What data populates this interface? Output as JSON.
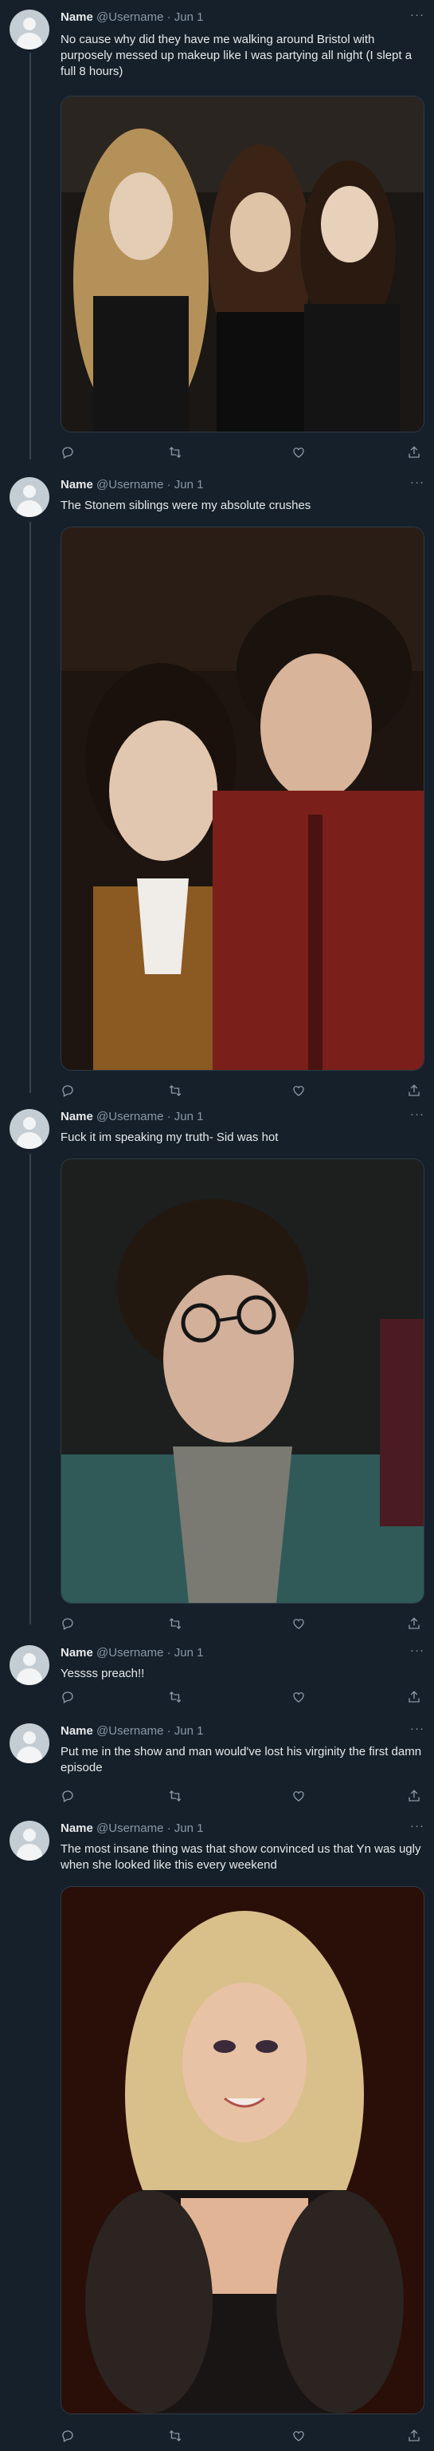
{
  "colors": {
    "background": "#15202b",
    "text": "#e7e9ea",
    "muted": "#8b98a5",
    "divider": "#38444d"
  },
  "tweets": [
    {
      "name": "Name",
      "handle": "@Username",
      "sep": "·",
      "date": "Jun 1",
      "text": "No cause why did they have me walking around Bristol with purposely messed up makeup like I was partying all night (I slept a full 8 hours)",
      "media": "photo-three-girls"
    },
    {
      "name": "Name",
      "handle": "@Username",
      "sep": "·",
      "date": "Jun 1",
      "text": "The Stonem siblings were my absolute crushes",
      "media": "photo-siblings"
    },
    {
      "name": "Name",
      "handle": "@Username",
      "sep": "·",
      "date": "Jun 1",
      "text": "Fuck it im speaking my truth- Sid was hot",
      "media": "photo-sid"
    },
    {
      "name": "Name",
      "handle": "@Username",
      "sep": "·",
      "date": "Jun 1",
      "text": "Yessss preach!!"
    },
    {
      "name": "Name",
      "handle": "@Username",
      "sep": "·",
      "date": "Jun 1",
      "text": "Put me in the show and man would've lost his virginity the first damn episode"
    },
    {
      "name": "Name",
      "handle": "@Username",
      "sep": "·",
      "date": "Jun 1",
      "text": "The most insane thing was that show convinced us that Yn was ugly when she looked like this every weekend",
      "media": "photo-blonde"
    }
  ],
  "icons": [
    "reply-icon",
    "retweet-icon",
    "like-icon",
    "share-icon",
    "more-icon",
    "avatar-placeholder-icon"
  ]
}
